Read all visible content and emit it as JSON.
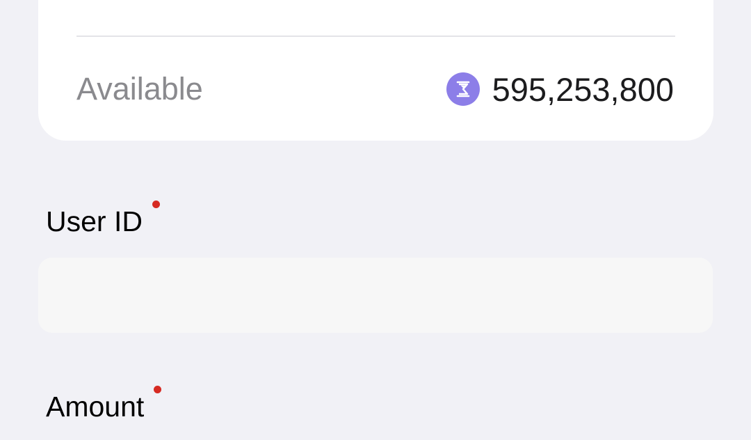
{
  "wallet": {
    "available_label": "Available",
    "available_amount": "595,253,800",
    "coin_icon": "hourglass-coin-icon",
    "coin_color": "#8c7ee8"
  },
  "form": {
    "user_id": {
      "label": "User ID",
      "value": "",
      "placeholder": "",
      "required": true
    },
    "amount": {
      "label": "Amount",
      "required": true
    },
    "required_color": "#d62a22"
  }
}
